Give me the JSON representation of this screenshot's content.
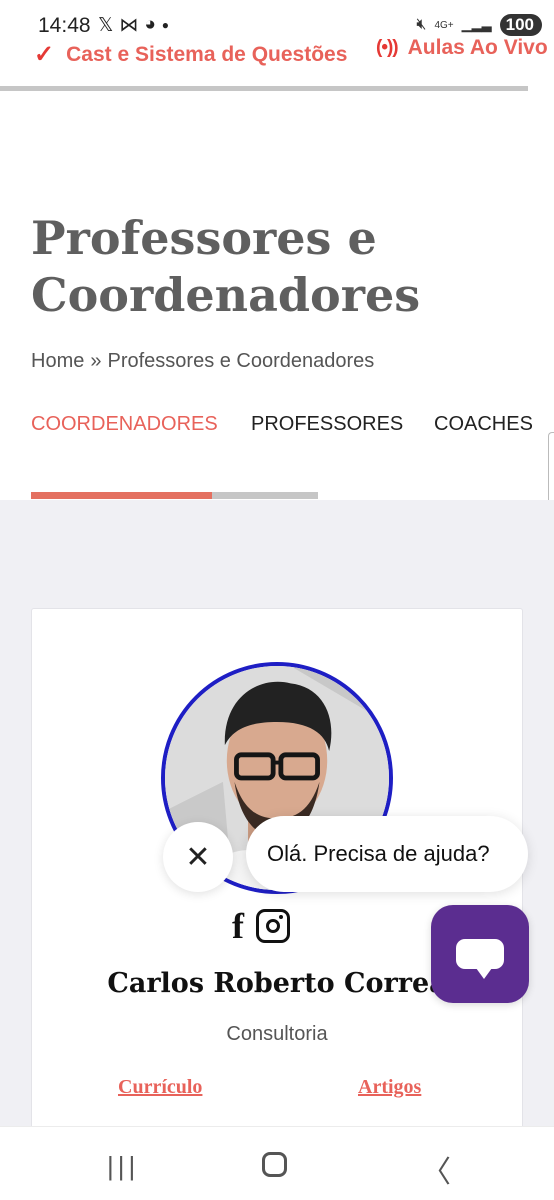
{
  "status_bar": {
    "time": "14:48",
    "left_icons": [
      "x-icon",
      "capcut-icon",
      "discord-icon",
      "dot-icon"
    ],
    "network": "4G+",
    "battery": "100"
  },
  "top_links": {
    "cast": "Cast e Sistema de Questões",
    "live": "Aulas Ao Vivo",
    "live_icon_glyph": "(•))"
  },
  "page": {
    "title": "Professores e Coordenadores"
  },
  "breadcrumb": {
    "home": "Home",
    "separator": "»",
    "current": "Professores e Coordenadores"
  },
  "tabs": [
    {
      "label": "COORDENADORES",
      "active": true
    },
    {
      "label": "PROFESSORES",
      "active": false
    },
    {
      "label": "COACHES",
      "active": false
    }
  ],
  "profile": {
    "name": "Carlos Roberto Correa",
    "role": "Consultoria",
    "social": [
      "facebook-icon",
      "instagram-icon"
    ],
    "links": {
      "curriculo": "Currículo",
      "artigos": "Artigos"
    }
  },
  "chat": {
    "greeting": "Olá. Precisa de ajuda?",
    "close_glyph": "✕"
  },
  "colors": {
    "accent": "#e8625a",
    "chat_button": "#5b2d90",
    "avatar_ring": "#1e1ec4",
    "title": "#5f5f5f"
  }
}
